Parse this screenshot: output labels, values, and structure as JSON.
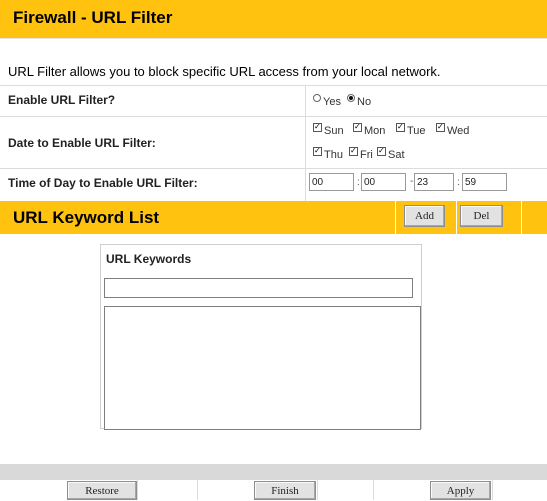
{
  "header": {
    "title": "Firewall - URL Filter"
  },
  "description": "URL Filter allows you to block specific URL access from your local network.",
  "enable": {
    "label": "Enable URL Filter?",
    "options": [
      {
        "label": "Yes",
        "selected": false
      },
      {
        "label": "No",
        "selected": true
      }
    ]
  },
  "dates": {
    "label": "Date to Enable URL Filter:",
    "days": [
      {
        "label": "Sun",
        "checked": true
      },
      {
        "label": "Mon",
        "checked": true
      },
      {
        "label": "Tue",
        "checked": true
      },
      {
        "label": "Wed",
        "checked": true
      },
      {
        "label": "Thu",
        "checked": true
      },
      {
        "label": "Fri",
        "checked": true
      },
      {
        "label": "Sat",
        "checked": true
      }
    ]
  },
  "time": {
    "label": "Time of Day to Enable URL Filter:",
    "start_hour": "00",
    "start_minute": "00",
    "end_hour": "23",
    "end_minute": "59",
    "sep_colon": ":",
    "sep_dash": "-"
  },
  "keywords": {
    "section_title": "URL Keyword List",
    "add_label": "Add",
    "del_label": "Del",
    "column_header": "URL Keywords",
    "input_value": "",
    "items": []
  },
  "footer": {
    "restore_label": "Restore",
    "finish_label": "Finish",
    "apply_label": "Apply"
  },
  "colors": {
    "accent": "#ffc20e",
    "footer_band": "#d9d9d9"
  }
}
